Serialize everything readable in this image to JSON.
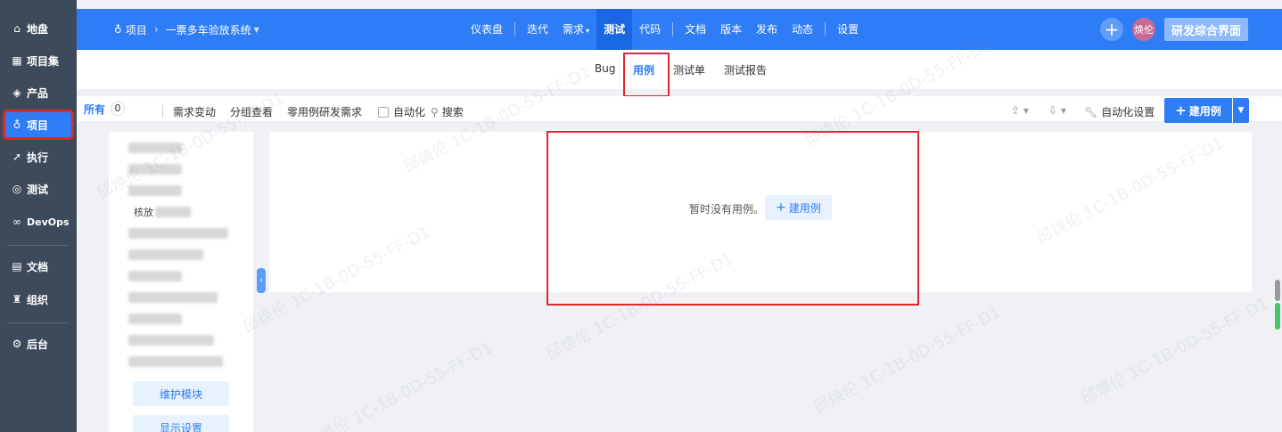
{
  "sidebar": {
    "items": [
      {
        "icon": "home-icon",
        "glyph": "⌂",
        "label": "地盘"
      },
      {
        "icon": "grid-icon",
        "glyph": "▦",
        "label": "项目集"
      },
      {
        "icon": "product-icon",
        "glyph": "◈",
        "label": "产品"
      },
      {
        "icon": "project-icon",
        "glyph": "♁",
        "label": "项目"
      },
      {
        "icon": "run-icon",
        "glyph": "➚",
        "label": "执行"
      },
      {
        "icon": "test-search-icon",
        "glyph": "◎",
        "label": "测试"
      },
      {
        "icon": "devops-icon",
        "glyph": "∞",
        "label": "DevOps"
      },
      {
        "icon": "doc-icon",
        "glyph": "▤",
        "label": "文档"
      },
      {
        "icon": "org-icon",
        "glyph": "♜",
        "label": "组织"
      },
      {
        "icon": "settings-icon",
        "glyph": "⚙",
        "label": "后台"
      }
    ]
  },
  "topbar": {
    "breadcrumb_root": "项目",
    "breadcrumb_project": "一票多车验放系统",
    "nav": [
      "仪表盘",
      "迭代",
      "需求",
      "测试",
      "代码",
      "文档",
      "版本",
      "发布",
      "动态",
      "设置"
    ],
    "avatar_text": "焕伦",
    "rd_button": "研发综合界面"
  },
  "subtabs": [
    "Bug",
    "用例",
    "测试单",
    "测试报告"
  ],
  "toolbar": {
    "all_label": "所有",
    "all_count": "0",
    "filters": [
      "需求变动",
      "分组查看",
      "零用例研发需求"
    ],
    "automation_checkbox": "自动化",
    "search_label": "搜索",
    "auto_settings": "自动化设置",
    "new_case": "建用例"
  },
  "module_tree": {
    "visible_text": "核放",
    "maintain_button": "维护模块",
    "display_button": "显示设置"
  },
  "main": {
    "empty_message": "暂时没有用例。",
    "new_case_button": "建用例"
  },
  "watermark": "邱焕伦 1C-1B-0D-55-FF-D1",
  "colors": {
    "primary": "#2e7cf6",
    "sidebar_bg": "#3c4a5c",
    "highlight_red": "#e3262a"
  }
}
